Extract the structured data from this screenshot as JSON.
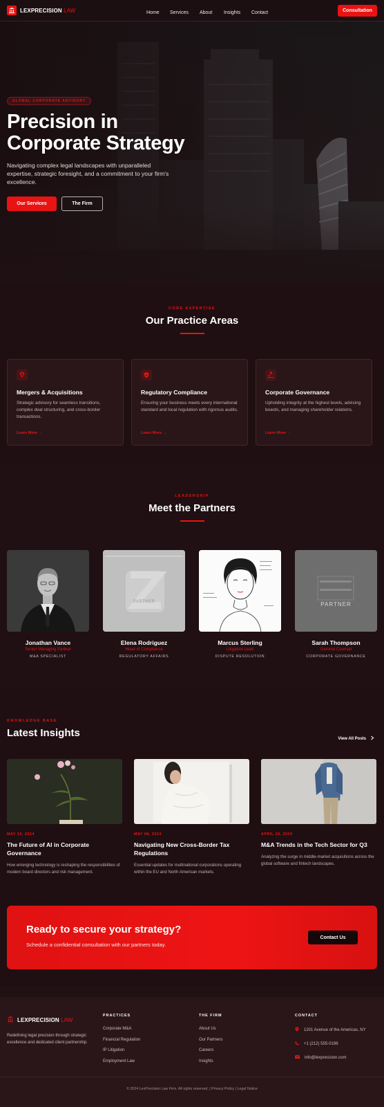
{
  "brand": {
    "name": "LEXPRECISION",
    "accent": "LAW",
    "color": "#e81313"
  },
  "nav": {
    "links": [
      "Home",
      "Services",
      "About",
      "Insights",
      "Contact"
    ],
    "cta": "Consultation"
  },
  "hero": {
    "badge": "GLOBAL CORPORATE ADVISORY",
    "title_line1": "Precision in",
    "title_line2": "Corporate Strategy",
    "subtitle": "Navigating complex legal landscapes with unparalleled expertise, strategic foresight, and a commitment to your firm's excellence.",
    "primary_button": "Our Services",
    "secondary_button": "The Firm"
  },
  "practice": {
    "eyebrow": "CORE EXPERTISE",
    "title": "Our Practice Areas",
    "cards": [
      {
        "icon": "diamond-icon",
        "title": "Mergers & Acquisitions",
        "desc": "Strategic advisory for seamless transitions, complex deal structuring, and cross-border transactions.",
        "link": "Learn More →"
      },
      {
        "icon": "shield-icon",
        "title": "Regulatory Compliance",
        "desc": "Ensuring your business meets every international standard and local regulation with rigorous audits.",
        "link": "Learn More →"
      },
      {
        "icon": "gavel-icon",
        "title": "Corporate Governance",
        "desc": "Upholding integrity at the highest levels, advising boards, and managing shareholder relations.",
        "link": "Learn More →"
      }
    ]
  },
  "partners": {
    "eyebrow": "LEADERSHIP",
    "title": "Meet the Partners",
    "people": [
      {
        "name": "Jonathan Vance",
        "role": "Senior Managing Partner",
        "specialty": "M&A SPECIALIST"
      },
      {
        "name": "Elena Rodriguez",
        "role": "Head of Compliance",
        "specialty": "REGULATORY AFFAIRS"
      },
      {
        "name": "Marcus Sterling",
        "role": "Litigation Lead",
        "specialty": "DISPUTE RESOLUTION"
      },
      {
        "name": "Sarah Thompson",
        "role": "General Counsel",
        "specialty": "CORPORATE GOVERNANCE"
      }
    ],
    "photo2_text": "PARTNER",
    "photo4_text": "PARTNER"
  },
  "insights": {
    "eyebrow": "KNOWLEDGE BASE",
    "title": "Latest Insights",
    "view_all": "View All Posts",
    "posts": [
      {
        "date": "MAY 14, 2024",
        "title": "The Future of AI in Corporate Governance",
        "desc": "How emerging technology is reshaping the responsibilities of modern board directors and risk management."
      },
      {
        "date": "MAY 08, 2024",
        "title": "Navigating New Cross-Border Tax Regulations",
        "desc": "Essential updates for multinational corporations operating within the EU and North American markets."
      },
      {
        "date": "APRIL 29, 2024",
        "title": "M&A Trends in the Tech Sector for Q3",
        "desc": "Analyzing the surge in middle-market acquisitions across the global software and fintech landscapes."
      }
    ]
  },
  "cta": {
    "title": "Ready to secure your strategy?",
    "subtitle": "Schedule a confidential consultation with our partners today.",
    "button": "Contact Us"
  },
  "footer": {
    "about": "Redefining legal precision through strategic excellence and dedicated client partnership.",
    "practices": {
      "heading": "PRACTICES",
      "links": [
        "Corporate M&A",
        "Financial Regulation",
        "IP Litigation",
        "Employment Law"
      ]
    },
    "firm": {
      "heading": "THE FIRM",
      "links": [
        "About Us",
        "Our Partners",
        "Careers",
        "Insights"
      ]
    },
    "contact": {
      "heading": "CONTACT",
      "address": "1201 Avenue of the Americas, NY",
      "phone": "+1 (212) 555-0198",
      "email": "info@lexprecision.com"
    },
    "copyright": "© 2024 LexPrecision Law Firm. All rights reserved. | Privacy Policy | Legal Notice"
  }
}
